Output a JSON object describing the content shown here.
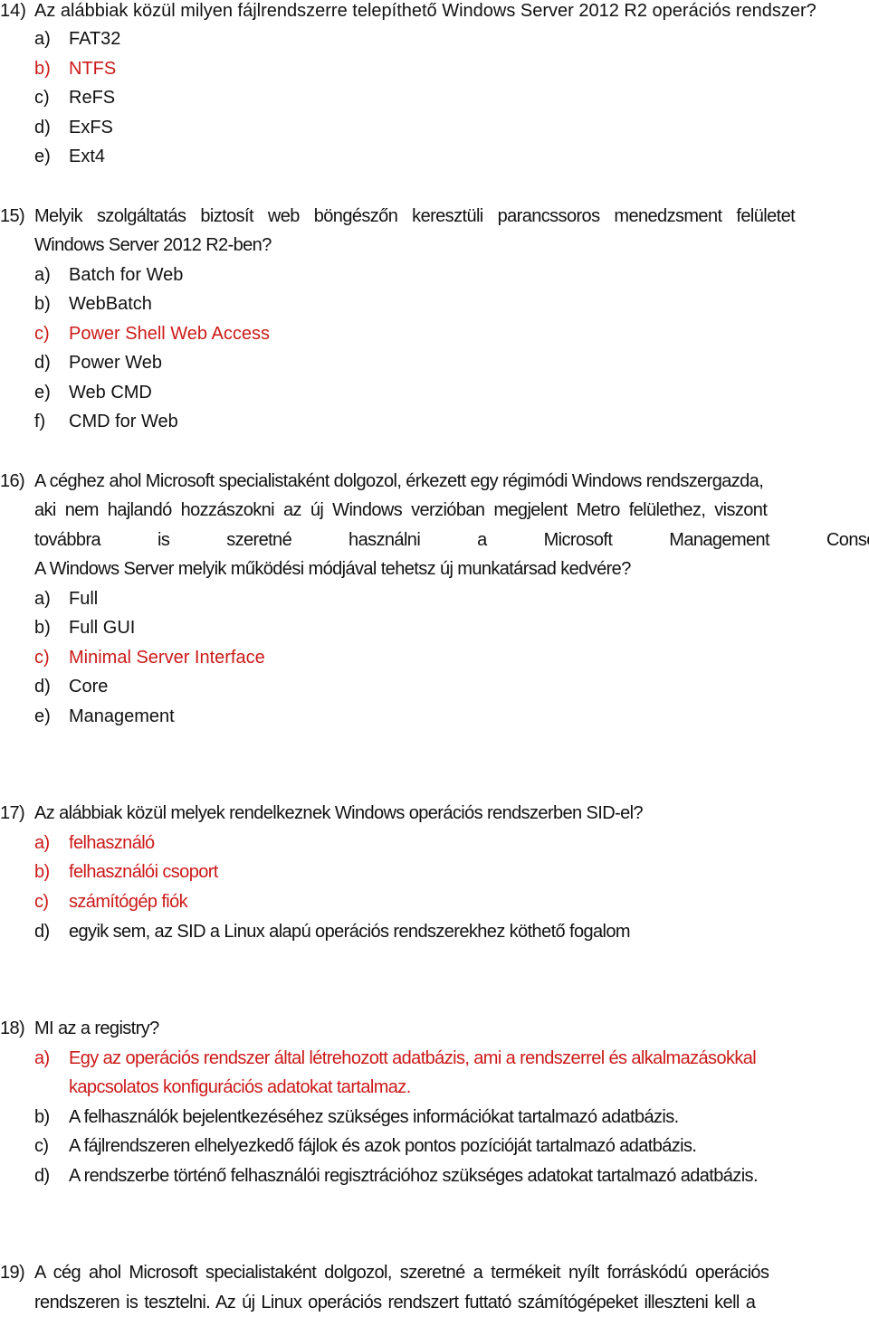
{
  "colors": {
    "text": "#111111",
    "answer_highlight": "#cc1a1a"
  },
  "questions": [
    {
      "number": "14)",
      "text_lines": [
        "Az alábbiak közül milyen fájlrendszerre telepíthető Windows Server 2012 R2 operációs rendszer?"
      ],
      "options": [
        {
          "label": "a)",
          "text": "FAT32",
          "correct": false
        },
        {
          "label": "b)",
          "text": "NTFS",
          "correct": true
        },
        {
          "label": "c)",
          "text": "ReFS",
          "correct": false
        },
        {
          "label": "d)",
          "text": "ExFS",
          "correct": false
        },
        {
          "label": "e)",
          "text": "Ext4",
          "correct": false
        }
      ]
    },
    {
      "number": "15)",
      "text_lines": [
        "Melyik szolgáltatás biztosít web böngészőn keresztüli parancssoros menedzsment felületet",
        "Windows Server 2012 R2-ben?"
      ],
      "options": [
        {
          "label": "a)",
          "text": "Batch for Web",
          "correct": false
        },
        {
          "label": "b)",
          "text": "WebBatch",
          "correct": false
        },
        {
          "label": "c)",
          "text": "Power Shell Web Access",
          "correct": true
        },
        {
          "label": "d)",
          "text": "Power Web",
          "correct": false
        },
        {
          "label": "e)",
          "text": "Web CMD",
          "correct": false
        },
        {
          "label": "f)",
          "text": "CMD for Web",
          "correct": false
        }
      ]
    },
    {
      "number": "16)",
      "text_lines": [
        "A céghez ahol Microsoft specialistaként dolgozol, érkezett egy régimódi Windows rendszergazda,",
        "aki nem hajlandó hozzászokni az új Windows verzióban megjelent Metro felülethez, viszont",
        "továbbra is szeretné használni a Microsoft Management Console-jait.",
        "A Windows Server melyik működési módjával tehetsz új munkatársad kedvére?"
      ],
      "options": [
        {
          "label": "a)",
          "text": "Full",
          "correct": false
        },
        {
          "label": "b)",
          "text": "Full GUI",
          "correct": false
        },
        {
          "label": "c)",
          "text": "Minimal Server Interface",
          "correct": true
        },
        {
          "label": "d)",
          "text": "Core",
          "correct": false
        },
        {
          "label": "e)",
          "text": "Management",
          "correct": false
        }
      ]
    },
    {
      "number": "17)",
      "text_lines": [
        "Az alábbiak közül melyek rendelkeznek Windows operációs rendszerben SID-el?"
      ],
      "options": [
        {
          "label": "a)",
          "text": "felhasználó",
          "correct": true
        },
        {
          "label": "b)",
          "text": "felhasználói csoport",
          "correct": true
        },
        {
          "label": "c)",
          "text": "számítógép fiók",
          "correct": true
        },
        {
          "label": "d)",
          "text": "egyik sem, az SID a Linux alapú operációs rendszerekhez köthető fogalom",
          "correct": false
        }
      ]
    },
    {
      "number": "18)",
      "text_lines": [
        "MI az a registry?"
      ],
      "options": [
        {
          "label": "a)",
          "text": "Egy az operációs rendszer által létrehozott adatbázis, ami a rendszerrel és alkalmazásokkal",
          "text_cont": "kapcsolatos konfigurációs adatokat tartalmaz.",
          "correct": true
        },
        {
          "label": "b)",
          "text": "A felhasználók bejelentkezéséhez szükséges információkat tartalmazó adatbázis.",
          "correct": false
        },
        {
          "label": "c)",
          "text": "A fájlrendszeren elhelyezkedő fájlok és azok pontos pozícióját tartalmazó adatbázis.",
          "correct": false
        },
        {
          "label": "d)",
          "text": "A rendszerbe történő felhasználói regisztrációhoz szükséges adatokat tartalmazó adatbázis.",
          "correct": false
        }
      ]
    },
    {
      "number": "19)",
      "text_lines": [
        "A cég ahol Microsoft specialistaként dolgozol, szeretné a termékeit nyílt forráskódú operációs",
        "rendszeren is tesztelni. Az új Linux operációs rendszert futtató számítógépeket illeszteni kell a"
      ],
      "options": []
    }
  ]
}
